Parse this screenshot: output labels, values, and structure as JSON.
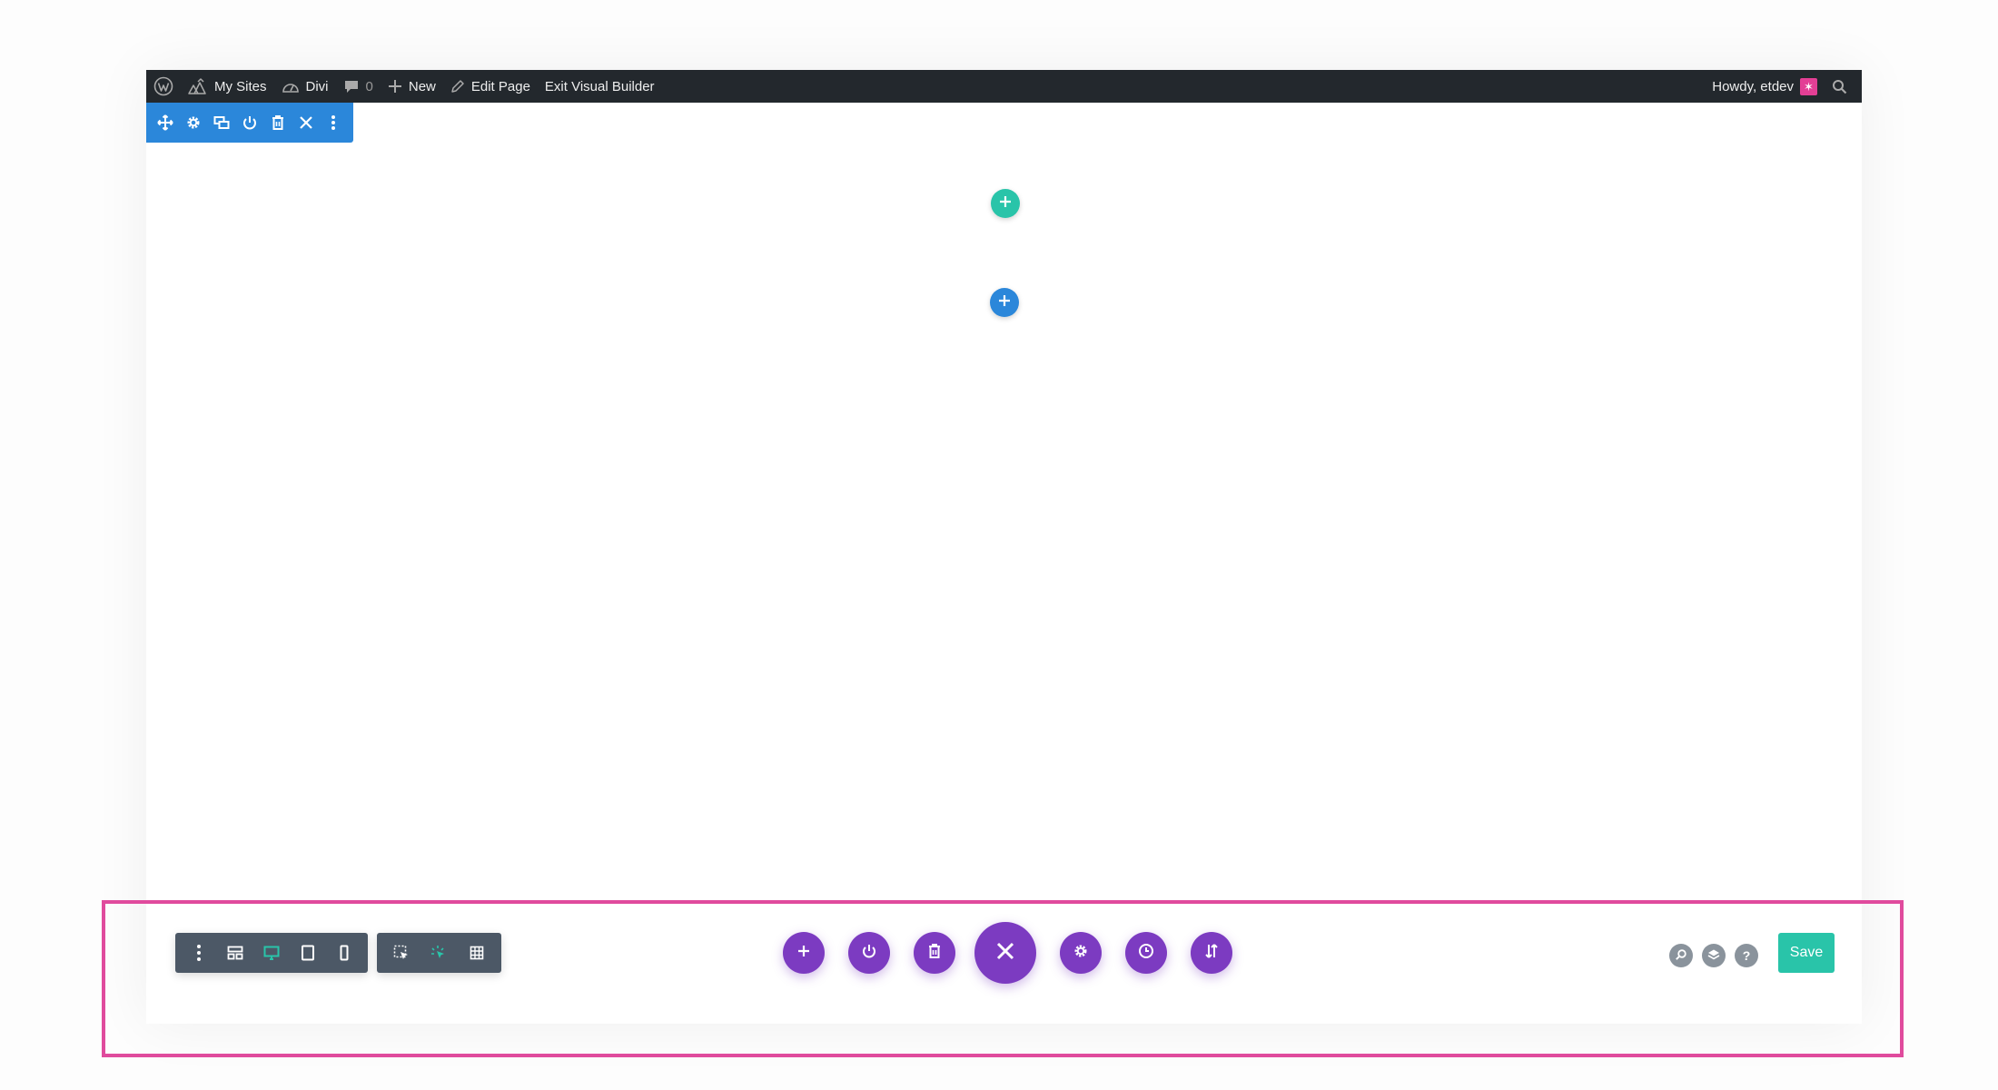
{
  "admin_bar": {
    "my_sites": "My Sites",
    "site_name": "Divi",
    "comments_count": "0",
    "new_label": "New",
    "edit_page": "Edit Page",
    "exit_builder": "Exit Visual Builder",
    "howdy": "Howdy, etdev"
  },
  "section_toolbar": {
    "icons": [
      "move-icon",
      "gear-icon",
      "duplicate-icon",
      "power-icon",
      "trash-icon",
      "close-icon",
      "more-icon"
    ]
  },
  "canvas": {
    "add_section_color": "#29c4a9",
    "add_row_color": "#2b87da"
  },
  "bottom_bar": {
    "view_group": [
      "more-icon",
      "wireframe-icon",
      "desktop-icon",
      "tablet-icon",
      "phone-icon"
    ],
    "mode_group": [
      "click-mode-icon",
      "hover-mode-icon",
      "grid-mode-icon"
    ],
    "center_buttons": [
      "add-icon",
      "power-icon",
      "trash-icon",
      "close-icon",
      "gear-icon",
      "history-icon",
      "portability-icon"
    ],
    "right_icons": [
      "search-icon",
      "layers-icon",
      "help-icon"
    ],
    "help_glyph": "?",
    "save_label": "Save"
  },
  "colors": {
    "admin_bar": "#23282d",
    "section_blue": "#2b87da",
    "accent_green": "#29c4a9",
    "purple": "#7c3bc1",
    "dark_group": "#4c5866",
    "highlight": "#e04b9d"
  }
}
